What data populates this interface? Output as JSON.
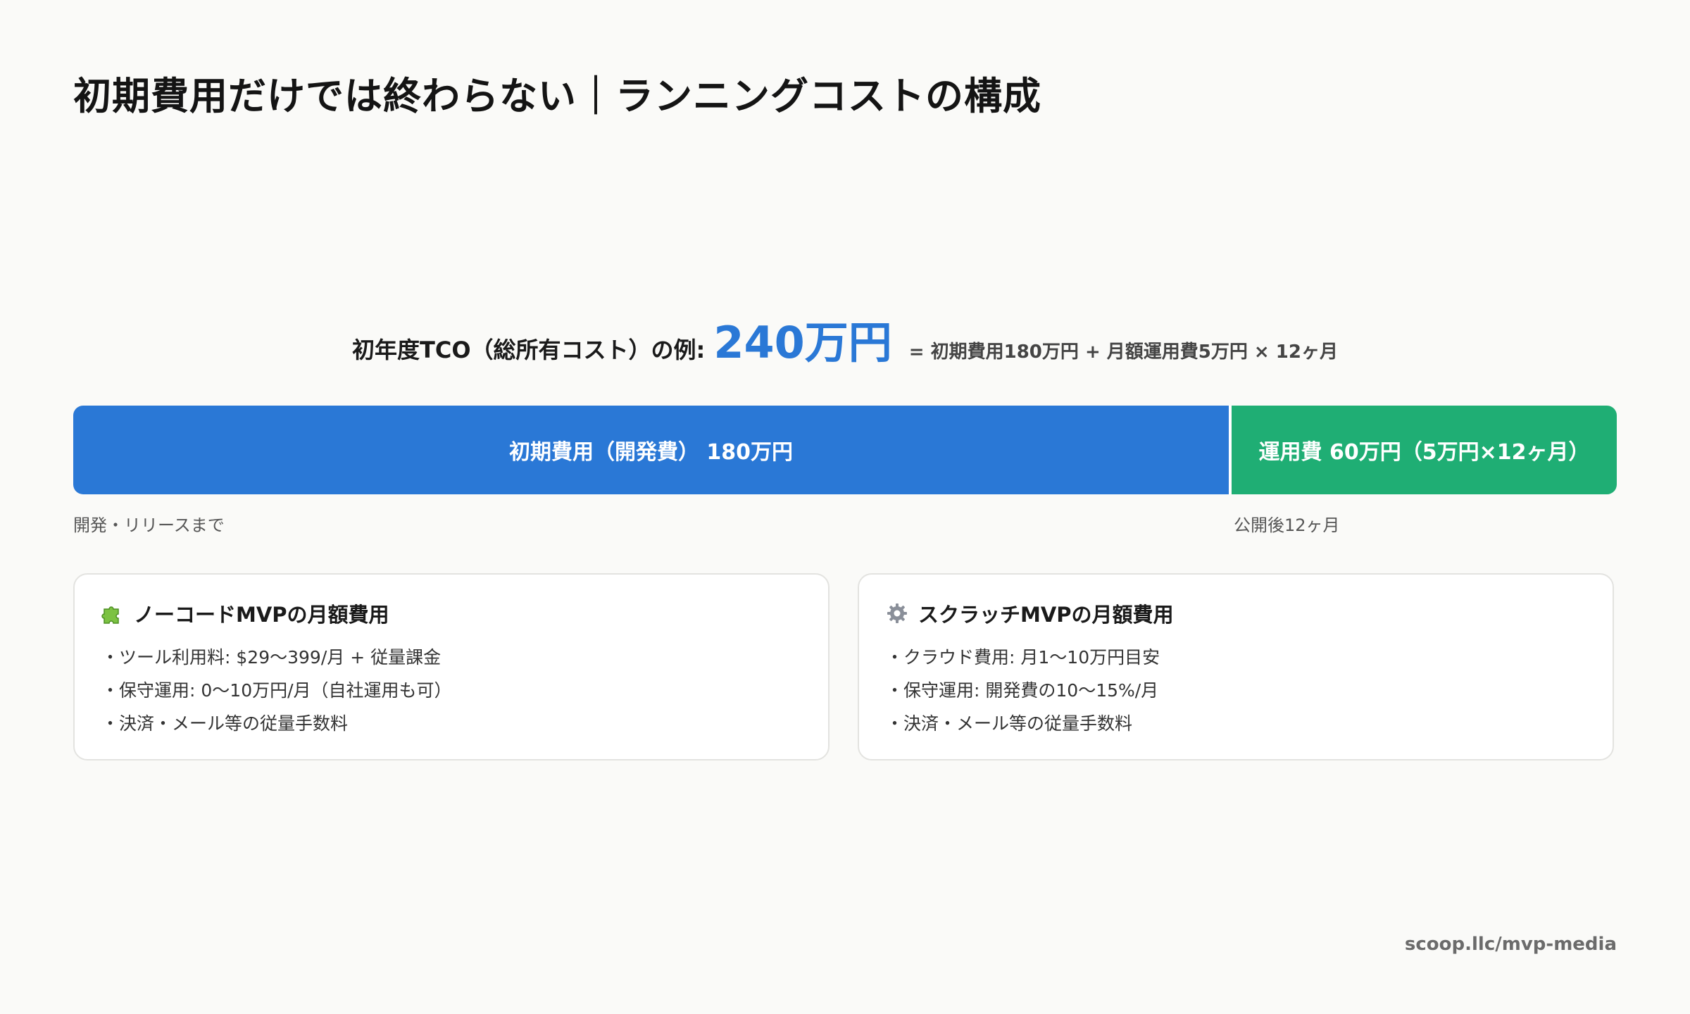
{
  "title": "初期費用だけでは終わらない｜ランニングコストの構成",
  "tco": {
    "label": "初年度TCO（総所有コスト）の例:",
    "value": "240万円",
    "formula": "= 初期費用180万円 + 月額運用費5万円 × 12ヶ月"
  },
  "bar": {
    "initial": {
      "label": "初期費用（開発費） 180万円",
      "amount": 180,
      "note": "開発・リリースまで",
      "color": "#2a78d6"
    },
    "running": {
      "label": "運用費 60万円（5万円×12ヶ月）",
      "amount": 60,
      "note": "公開後12ヶ月",
      "color": "#1fae74"
    }
  },
  "cards": [
    {
      "icon": "puzzle-piece-icon",
      "title": "ノーコードMVPの月額費用",
      "items": [
        "ツール利用料: $29〜399/月 + 従量課金",
        "保守運用: 0〜10万円/月（自社運用も可）",
        "決済・メール等の従量手数料"
      ]
    },
    {
      "icon": "gear-icon",
      "title": "スクラッチMVPの月額費用",
      "items": [
        "クラウド費用: 月1〜10万円目安",
        "保守運用: 開発費の10〜15%/月",
        "決済・メール等の従量手数料"
      ]
    }
  ],
  "footer": "scoop.llc/mvp-media"
}
